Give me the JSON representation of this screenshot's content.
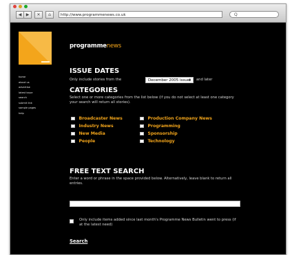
{
  "browser": {
    "url": "http://www.programmenews.co.uk",
    "nav_back": "◀",
    "nav_forward": "▶",
    "nav_stop": "✕",
    "nav_home": "⌂",
    "search_icon": "magnifier-icon",
    "search_glyph": "Q"
  },
  "brand": {
    "name": "programme",
    "accent": "news"
  },
  "sidebar": {
    "items": [
      {
        "label": "home"
      },
      {
        "label": "about us"
      },
      {
        "label": "advertise"
      },
      {
        "label": "latest issue"
      },
      {
        "label": "search"
      },
      {
        "label": "submit link"
      },
      {
        "label": "sample pages"
      },
      {
        "label": "help"
      }
    ]
  },
  "issue_dates": {
    "heading": "ISSUE DATES",
    "prefix": "Only include stories from the",
    "selected": "December 2005 issue",
    "suffix": "and later"
  },
  "categories": {
    "heading": "CATEGORIES",
    "description": "Select one or more categories from the list below (if you do not select at least one category your search will return all stories).",
    "left": [
      {
        "label": "Broadcaster News"
      },
      {
        "label": "Industry News"
      },
      {
        "label": "New Media"
      },
      {
        "label": "People"
      }
    ],
    "right": [
      {
        "label": "Production Company News"
      },
      {
        "label": "Programming"
      },
      {
        "label": "Sponsorship"
      },
      {
        "label": "Technology"
      }
    ]
  },
  "free_text": {
    "heading": "FREE TEXT SEARCH",
    "description": "Enter a word or phrase in the space provided below. Alternatively, leave blank to return all entries.",
    "value": ""
  },
  "recent_only": {
    "label": "Only include items added since last month's Programme News Bulletin went to press (if at the latest need)"
  },
  "search_label": "Search",
  "colors": {
    "accent": "#f3a51b",
    "background": "#000000",
    "text": "#ffffff"
  }
}
